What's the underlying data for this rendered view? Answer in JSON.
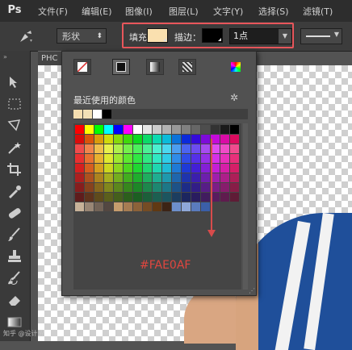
{
  "menubar": {
    "logo": "Ps",
    "items": [
      "文件(F)",
      "编辑(E)",
      "图像(I)",
      "图层(L)",
      "文字(Y)",
      "选择(S)",
      "滤镜(T)"
    ]
  },
  "options": {
    "shape_mode": "形状",
    "fill_label": "填充：",
    "fill_color": "#FAE0AF",
    "stroke_label": "描边：",
    "stroke_color": "#000000",
    "stroke_width": "1点",
    "highlight_color": "#e8565b"
  },
  "doc_tab": "PHC",
  "popup": {
    "modes": [
      "no-color-icon",
      "solid-color-icon",
      "gradient-icon",
      "pattern-icon",
      "color-picker-icon"
    ],
    "recent_title": "最近使用的颜色",
    "recent_colors": [
      "#f5deb0",
      "#f2e0b6",
      "#ffffff",
      "#000000"
    ],
    "hex_label": "#FAE0AF",
    "annotation_color": "#d84b4b"
  },
  "watermark": "知乎 @设计喵"
}
